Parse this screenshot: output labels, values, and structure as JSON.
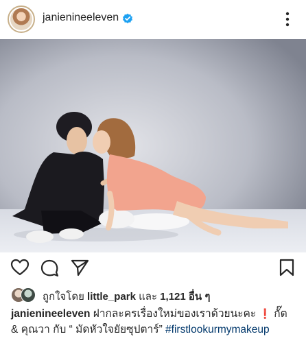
{
  "post": {
    "username": "janienineeleven",
    "verified": true
  },
  "header_icons": {
    "avatar": "profile-avatar",
    "verified": "verified-badge-icon",
    "more": "more-options-icon"
  },
  "photo": {
    "tag_icon": "person-tag-icon"
  },
  "actions": {
    "like": "heart-icon",
    "comment": "comment-icon",
    "share": "send-icon",
    "save": "bookmark-icon"
  },
  "likes": {
    "prefix": "ถูกใจโดย",
    "liker": "little_park",
    "conjunction": "และ",
    "count": "1,121",
    "suffix": "อื่น ๆ"
  },
  "caption": {
    "username": "janienineeleven",
    "text": "ฝากละครเรื่องใหม่ของเราด้วยนะคะ",
    "emoji": "❗",
    "mentions": "กั๊ต & คุณวา กับ “ มัดหัวใจยัยซุปตาร์” ",
    "hashtag": "#firstlookurmymakeup"
  },
  "colors": {
    "verified": "#1da1f2",
    "hashtag": "#00376b",
    "text": "#262626"
  }
}
